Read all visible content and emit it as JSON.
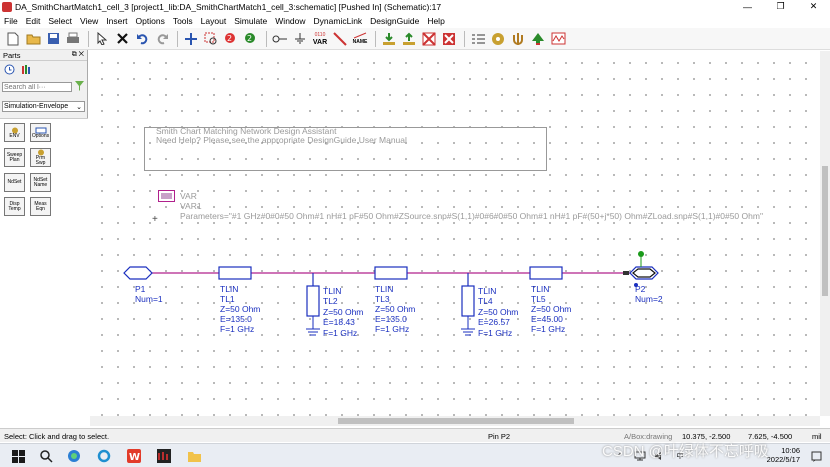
{
  "window": {
    "title": "DA_SmithChartMatch1_cell_3 [project1_lib:DA_SmithChartMatch1_cell_3:schematic] [Pushed In] (Schematic):17",
    "buttons": {
      "minimize": "—",
      "restore": "❐",
      "close": "✕"
    }
  },
  "menu": [
    "File",
    "Edit",
    "Select",
    "View",
    "Insert",
    "Options",
    "Tools",
    "Layout",
    "Simulate",
    "Window",
    "DynamicLink",
    "DesignGuide",
    "Help"
  ],
  "toolbar": {
    "var_label": "VAR",
    "var_code": "0110",
    "name_label": "NAME"
  },
  "parts": {
    "title": "Parts",
    "search_placeholder": "Search all l···",
    "palette": "Simulation-Envelope",
    "buttons": [
      {
        "top": "ENV",
        "bottom": ""
      },
      {
        "top": "Options",
        "bottom": ""
      },
      {
        "top": "Sweep",
        "bottom": "Plan"
      },
      {
        "top": "Prm Swp",
        "bottom": ""
      },
      {
        "top": "NdSet",
        "bottom": ""
      },
      {
        "top": "NdSet",
        "bottom": "Name"
      },
      {
        "top": "Disp",
        "bottom": "Temp"
      },
      {
        "top": "Meas",
        "bottom": "Eqn"
      }
    ]
  },
  "schematic": {
    "designguide_title": "Smith Chart Matching Network Design Assistant",
    "designguide_help": "Need Help?  Please see the appropriate DesignGuide User Manual",
    "var_label": "VAR",
    "var_name": "VAR1",
    "var_params": "Parameters=\"#1 GHz#0#0#50 Ohm#1 nH#1 pF#50 Ohm#ZSource.snp#S(1,1)#0#6#0#50 Ohm#1 nH#1 pF#(50+j*50) Ohm#ZLoad.snp#S(1,1)#0#50 Ohm\"",
    "port1": {
      "name": "P1",
      "num": "Num=1"
    },
    "port2": {
      "name": "P2",
      "num": "Num=2"
    },
    "tlines": [
      {
        "type": "TLIN",
        "name": "TL1",
        "z": "Z=50 Ohm",
        "e": "E=135.0",
        "f": "F=1 GHz"
      },
      {
        "type": "TLIN",
        "name": "TL2",
        "z": "Z=50 Ohm",
        "e": "E=18.43",
        "f": "F=1 GHz"
      },
      {
        "type": "TLIN",
        "name": "TL3",
        "z": "Z=50 Ohm",
        "e": "E=135.0",
        "f": "F=1 GHz"
      },
      {
        "type": "TLIN",
        "name": "TL4",
        "z": "Z=50 Ohm",
        "e": "E=26.57",
        "f": "F=1 GHz"
      },
      {
        "type": "TLIN",
        "name": "TL5",
        "z": "Z=50 Ohm",
        "e": "E=45.00",
        "f": "F=1 GHz"
      }
    ]
  },
  "status": {
    "hint": "Select: Click and drag to select.",
    "pin": "Pin P2",
    "mode": "A/Box:drawing",
    "coord1": "10.375, -2.500",
    "coord2": "7.625, -4.500",
    "unit": "mil"
  },
  "taskbar": {
    "time": "10:06",
    "date": "2022/5/17",
    "watermark": "CSDN @叶绿体不忘呼吸"
  },
  "colors": {
    "wire": "#b0208c",
    "component": "#1a2fbf",
    "ground": "#2a7a2a",
    "pin_marker": "#1a9a1a"
  }
}
